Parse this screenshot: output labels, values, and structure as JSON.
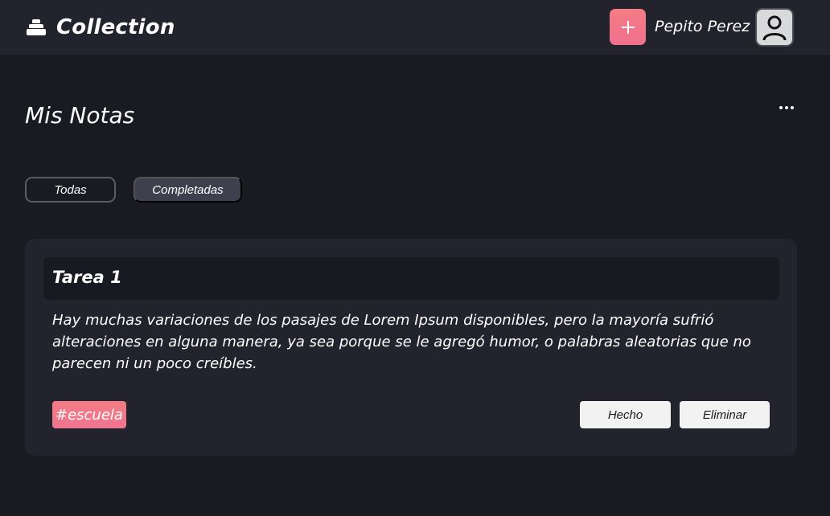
{
  "header": {
    "brand_title": "Collection",
    "brand_icon": "stack-icon",
    "add_icon": "plus-icon",
    "user_name": "Pepito Perez",
    "avatar_icon": "user-icon"
  },
  "page": {
    "title": "Mis Notas",
    "more_icon": "more-horizontal-icon"
  },
  "filters": [
    {
      "label": "Todas"
    },
    {
      "label": "Completadas"
    }
  ],
  "note": {
    "title": "Tarea 1",
    "body": "Hay muchas variaciones de los pasajes de Lorem Ipsum disponibles, pero la mayoría sufrió alteraciones en alguna manera, ya sea porque se le agregó humor, o palabras aleatorias que no parecen ni un poco creíbles.",
    "tag": "#escuela",
    "done_label": "Hecho",
    "delete_label": "Eliminar"
  },
  "colors": {
    "background": "#1a1b21",
    "header": "#22232d",
    "card": "#22232d",
    "accent": "#f47c84"
  }
}
